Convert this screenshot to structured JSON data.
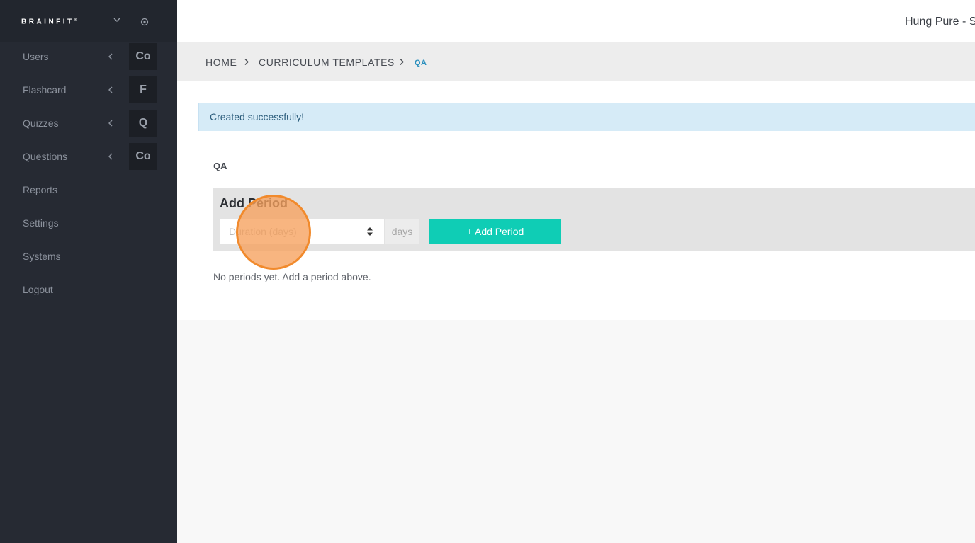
{
  "app": {
    "brand": "BRAINFIT",
    "brand_mark": "®"
  },
  "sidebar": {
    "items": [
      {
        "label": "Users",
        "badge": "Co",
        "icon": "chevron-left-icon"
      },
      {
        "label": "Flashcard",
        "badge": "F",
        "icon": "chevron-left-icon"
      },
      {
        "label": "Quizzes",
        "badge": "Q",
        "icon": "chevron-left-icon"
      },
      {
        "label": "Questions",
        "badge": "Co",
        "icon": "chevron-left-icon"
      },
      {
        "label": "Reports"
      },
      {
        "label": "Settings"
      },
      {
        "label": "Systems"
      },
      {
        "label": "Logout"
      }
    ]
  },
  "header": {
    "user_name": "Hung Pure - S"
  },
  "breadcrumb": {
    "home": "HOME",
    "templates": "CURRICULUM TEMPLATES",
    "current": "QA"
  },
  "alert": {
    "message": "Created successfully!"
  },
  "template": {
    "title": "QA"
  },
  "add_period": {
    "heading": "Add Period",
    "duration_placeholder": "Duration (days)",
    "duration_value": "",
    "unit": "days",
    "button_label": "+ Add Period"
  },
  "periods": {
    "empty_message": "No periods yet. Add a period above."
  },
  "colors": {
    "sidebar_bg": "#262a33",
    "accent": "#0fcdb5",
    "alert_bg": "#d6ebf7",
    "breadcrumb_active": "#2a8fbd",
    "click_marker": "#f18a2c"
  }
}
